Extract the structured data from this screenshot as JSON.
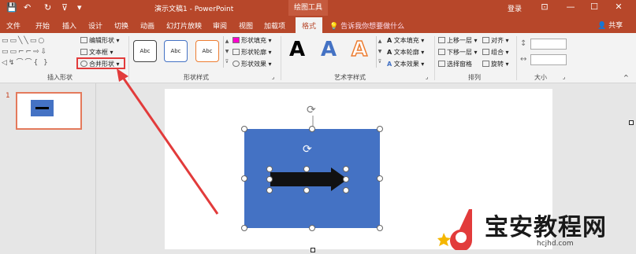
{
  "titlebar": {
    "quick_access": {
      "save": "💾",
      "undo": "↶",
      "redo": "↻",
      "present": "⊽",
      "more": "▾"
    },
    "doc_title": "演示文稿1 - PowerPoint",
    "context_title": "绘图工具",
    "login": "登录",
    "ribbon_display": "⊡",
    "minimize": "—",
    "maximize": "☐",
    "close": "✕"
  },
  "tabs": [
    "文件",
    "开始",
    "插入",
    "设计",
    "切换",
    "动画",
    "幻灯片放映",
    "审阅",
    "视图",
    "加载项",
    "格式"
  ],
  "tellme": "告诉我你想要做什么",
  "share": "共享",
  "ribbon": {
    "insert_shapes": {
      "label": "插入形状",
      "edit_shape": "编辑形状",
      "text_box": "文本框",
      "merge_shapes": "合并形状"
    },
    "shape_styles": {
      "label": "形状样式",
      "samples": [
        "Abc",
        "Abc",
        "Abc"
      ],
      "fill": "形状填充",
      "outline": "形状轮廓",
      "effects": "形状效果"
    },
    "wordart": {
      "label": "艺术字样式",
      "samples": [
        "A",
        "A",
        "A"
      ],
      "text_fill": "文本填充",
      "text_outline": "文本轮廓",
      "text_effects": "文本效果"
    },
    "arrange": {
      "label": "排列",
      "bring_forward": "上移一层",
      "send_backward": "下移一层",
      "selection_pane": "选择窗格",
      "align": "对齐",
      "group": "组合",
      "rotate": "旋转"
    },
    "size": {
      "label": "大小"
    }
  },
  "thumbnails": [
    {
      "number": "1"
    }
  ],
  "watermark": {
    "text": "宝安教程网",
    "url": "hcjhd.com"
  },
  "colors": {
    "accent": "#b7472a",
    "shape_fill": "#4472c4",
    "highlight": "#e23b3b"
  }
}
